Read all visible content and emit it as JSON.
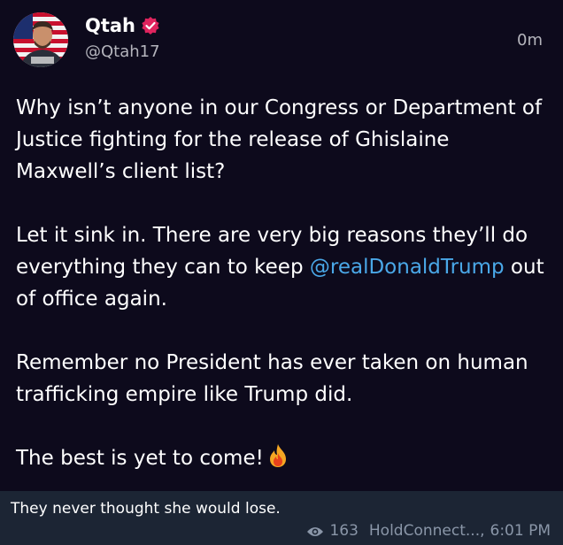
{
  "tweet": {
    "name": "Qtah",
    "handle": "@Qtah17",
    "time": "0m",
    "paragraphs": {
      "p1": "Why isn’t anyone in our Congress or Department of Justice fighting for the release of Ghislaine Maxwell’s client list?",
      "p2_before": "Let it sink in. There are very big reasons they’ll do everything they can to keep ",
      "p2_mention": "@realDonaldTrump",
      "p2_after": " out of office again.",
      "p3": "Remember no President has ever taken on human trafficking empire like Trump did.",
      "p4": "The best is yet to come!"
    }
  },
  "post": {
    "caption": "They never thought she would lose.",
    "views": "163",
    "author": "HoldConnect...,",
    "timestamp": "6:01 PM"
  },
  "colors": {
    "background": "#0d0a1c",
    "mention": "#4aa8e8",
    "caption_bar": "#1c2534"
  }
}
